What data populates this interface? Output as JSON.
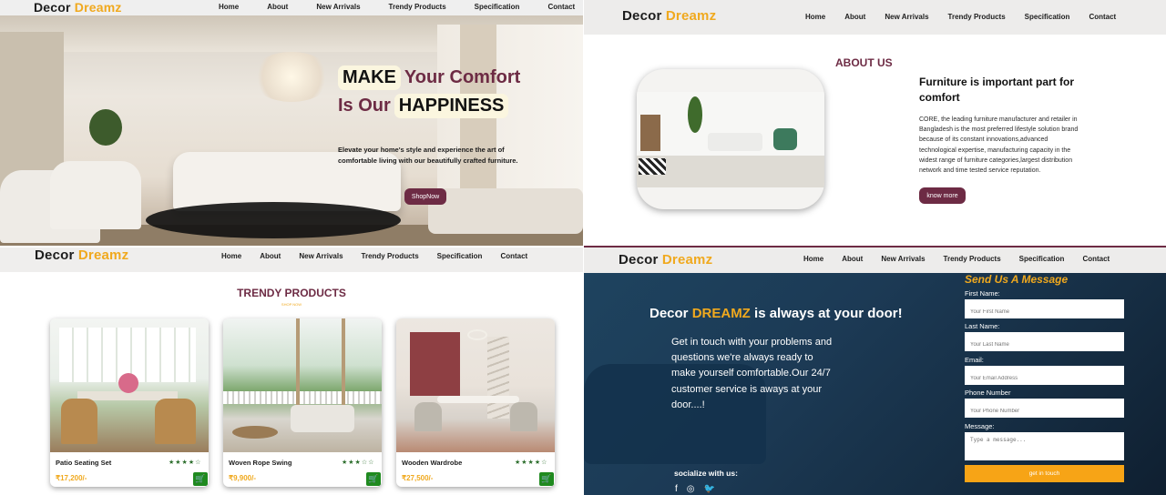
{
  "brand": {
    "name_part1": "Decor ",
    "name_part2": "Dreamz",
    "accent_color": "#f0a91e",
    "plum_color": "#6d2b44"
  },
  "nav": [
    "Home",
    "About",
    "New Arrivals",
    "Trendy Products",
    "Specification",
    "Contact"
  ],
  "hero": {
    "make": "MAKE",
    "your_comfort": "Your Comfort",
    "is_our": "Is Our",
    "happiness": "HAPPINESS",
    "text": "Elevate your home's style and experience the art of comfortable living with our beautifully crafted furniture.",
    "button": "ShopNow"
  },
  "about": {
    "title": "ABOUT US",
    "heading": "Furniture is important part for comfort",
    "body": "CORE, the leading furniture manufacturer and retailer in Bangladesh is the most preferred lifestyle solution brand because of its constant innovations,advanced technological expertise, manufacturing capacity in the widest range of furniture categories,largest distribution network and time tested service reputation.",
    "button": "know more"
  },
  "trendy": {
    "title": "TRENDY PRODUCTS",
    "subtitle": "SHOP NOW",
    "products": [
      {
        "name": "Patio Seating Set",
        "price": "₹17,200/-",
        "rating": 4
      },
      {
        "name": "Woven Rope Swing",
        "price": "₹9,900/-",
        "rating": 3
      },
      {
        "name": "Wooden Wardrobe",
        "price": "₹27,500/-",
        "rating": 4
      }
    ]
  },
  "contact": {
    "head_part1": "Decor ",
    "head_accent": "DREAMZ",
    "head_part2": " is always at your door!",
    "text": "Get in touch with your problems and questions we're always ready to make yourself comfortable.Our 24/7 customer service is aways at your door....!",
    "social_label": "socialize with us:",
    "social_icons": [
      "facebook-icon",
      "whatsapp-icon",
      "twitter-icon"
    ],
    "form_title": "Send Us A Message",
    "fields": [
      {
        "label": "First Name:",
        "placeholder": "Your First Name"
      },
      {
        "label": "Last Name:",
        "placeholder": "Your Last Name"
      },
      {
        "label": "Email:",
        "placeholder": "Your Email Address"
      },
      {
        "label": "Phone Number",
        "placeholder": "Your Phone Number"
      }
    ],
    "message_label": "Message:",
    "message_placeholder": "Type a message...",
    "submit": "get in touch"
  }
}
